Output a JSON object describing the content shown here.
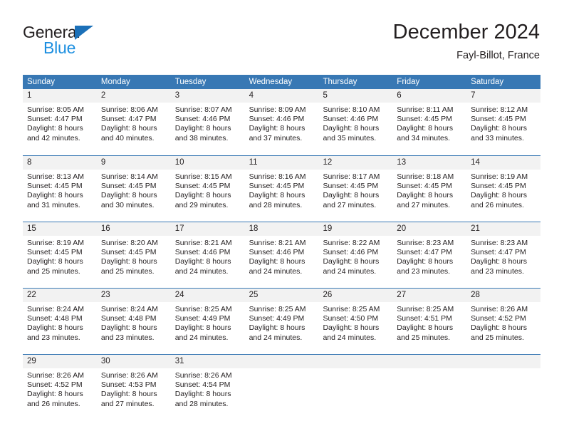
{
  "brand": {
    "name_top": "General",
    "name_bottom": "Blue",
    "color_dark": "#231f20",
    "color_blue": "#1b8ee0",
    "triangle_color": "#1b70b8"
  },
  "header": {
    "title": "December 2024",
    "location": "Fayl-Billot, France"
  },
  "theme": {
    "header_blue": "#3878b4",
    "day_band_gray": "#f2f2f2",
    "text": "#231f20"
  },
  "day_headers": [
    "Sunday",
    "Monday",
    "Tuesday",
    "Wednesday",
    "Thursday",
    "Friday",
    "Saturday"
  ],
  "weeks": [
    [
      {
        "day": "1",
        "sunrise": "Sunrise: 8:05 AM",
        "sunset": "Sunset: 4:47 PM",
        "daylight_1": "Daylight: 8 hours",
        "daylight_2": "and 42 minutes."
      },
      {
        "day": "2",
        "sunrise": "Sunrise: 8:06 AM",
        "sunset": "Sunset: 4:47 PM",
        "daylight_1": "Daylight: 8 hours",
        "daylight_2": "and 40 minutes."
      },
      {
        "day": "3",
        "sunrise": "Sunrise: 8:07 AM",
        "sunset": "Sunset: 4:46 PM",
        "daylight_1": "Daylight: 8 hours",
        "daylight_2": "and 38 minutes."
      },
      {
        "day": "4",
        "sunrise": "Sunrise: 8:09 AM",
        "sunset": "Sunset: 4:46 PM",
        "daylight_1": "Daylight: 8 hours",
        "daylight_2": "and 37 minutes."
      },
      {
        "day": "5",
        "sunrise": "Sunrise: 8:10 AM",
        "sunset": "Sunset: 4:46 PM",
        "daylight_1": "Daylight: 8 hours",
        "daylight_2": "and 35 minutes."
      },
      {
        "day": "6",
        "sunrise": "Sunrise: 8:11 AM",
        "sunset": "Sunset: 4:45 PM",
        "daylight_1": "Daylight: 8 hours",
        "daylight_2": "and 34 minutes."
      },
      {
        "day": "7",
        "sunrise": "Sunrise: 8:12 AM",
        "sunset": "Sunset: 4:45 PM",
        "daylight_1": "Daylight: 8 hours",
        "daylight_2": "and 33 minutes."
      }
    ],
    [
      {
        "day": "8",
        "sunrise": "Sunrise: 8:13 AM",
        "sunset": "Sunset: 4:45 PM",
        "daylight_1": "Daylight: 8 hours",
        "daylight_2": "and 31 minutes."
      },
      {
        "day": "9",
        "sunrise": "Sunrise: 8:14 AM",
        "sunset": "Sunset: 4:45 PM",
        "daylight_1": "Daylight: 8 hours",
        "daylight_2": "and 30 minutes."
      },
      {
        "day": "10",
        "sunrise": "Sunrise: 8:15 AM",
        "sunset": "Sunset: 4:45 PM",
        "daylight_1": "Daylight: 8 hours",
        "daylight_2": "and 29 minutes."
      },
      {
        "day": "11",
        "sunrise": "Sunrise: 8:16 AM",
        "sunset": "Sunset: 4:45 PM",
        "daylight_1": "Daylight: 8 hours",
        "daylight_2": "and 28 minutes."
      },
      {
        "day": "12",
        "sunrise": "Sunrise: 8:17 AM",
        "sunset": "Sunset: 4:45 PM",
        "daylight_1": "Daylight: 8 hours",
        "daylight_2": "and 27 minutes."
      },
      {
        "day": "13",
        "sunrise": "Sunrise: 8:18 AM",
        "sunset": "Sunset: 4:45 PM",
        "daylight_1": "Daylight: 8 hours",
        "daylight_2": "and 27 minutes."
      },
      {
        "day": "14",
        "sunrise": "Sunrise: 8:19 AM",
        "sunset": "Sunset: 4:45 PM",
        "daylight_1": "Daylight: 8 hours",
        "daylight_2": "and 26 minutes."
      }
    ],
    [
      {
        "day": "15",
        "sunrise": "Sunrise: 8:19 AM",
        "sunset": "Sunset: 4:45 PM",
        "daylight_1": "Daylight: 8 hours",
        "daylight_2": "and 25 minutes."
      },
      {
        "day": "16",
        "sunrise": "Sunrise: 8:20 AM",
        "sunset": "Sunset: 4:45 PM",
        "daylight_1": "Daylight: 8 hours",
        "daylight_2": "and 25 minutes."
      },
      {
        "day": "17",
        "sunrise": "Sunrise: 8:21 AM",
        "sunset": "Sunset: 4:46 PM",
        "daylight_1": "Daylight: 8 hours",
        "daylight_2": "and 24 minutes."
      },
      {
        "day": "18",
        "sunrise": "Sunrise: 8:21 AM",
        "sunset": "Sunset: 4:46 PM",
        "daylight_1": "Daylight: 8 hours",
        "daylight_2": "and 24 minutes."
      },
      {
        "day": "19",
        "sunrise": "Sunrise: 8:22 AM",
        "sunset": "Sunset: 4:46 PM",
        "daylight_1": "Daylight: 8 hours",
        "daylight_2": "and 24 minutes."
      },
      {
        "day": "20",
        "sunrise": "Sunrise: 8:23 AM",
        "sunset": "Sunset: 4:47 PM",
        "daylight_1": "Daylight: 8 hours",
        "daylight_2": "and 23 minutes."
      },
      {
        "day": "21",
        "sunrise": "Sunrise: 8:23 AM",
        "sunset": "Sunset: 4:47 PM",
        "daylight_1": "Daylight: 8 hours",
        "daylight_2": "and 23 minutes."
      }
    ],
    [
      {
        "day": "22",
        "sunrise": "Sunrise: 8:24 AM",
        "sunset": "Sunset: 4:48 PM",
        "daylight_1": "Daylight: 8 hours",
        "daylight_2": "and 23 minutes."
      },
      {
        "day": "23",
        "sunrise": "Sunrise: 8:24 AM",
        "sunset": "Sunset: 4:48 PM",
        "daylight_1": "Daylight: 8 hours",
        "daylight_2": "and 23 minutes."
      },
      {
        "day": "24",
        "sunrise": "Sunrise: 8:25 AM",
        "sunset": "Sunset: 4:49 PM",
        "daylight_1": "Daylight: 8 hours",
        "daylight_2": "and 24 minutes."
      },
      {
        "day": "25",
        "sunrise": "Sunrise: 8:25 AM",
        "sunset": "Sunset: 4:49 PM",
        "daylight_1": "Daylight: 8 hours",
        "daylight_2": "and 24 minutes."
      },
      {
        "day": "26",
        "sunrise": "Sunrise: 8:25 AM",
        "sunset": "Sunset: 4:50 PM",
        "daylight_1": "Daylight: 8 hours",
        "daylight_2": "and 24 minutes."
      },
      {
        "day": "27",
        "sunrise": "Sunrise: 8:25 AM",
        "sunset": "Sunset: 4:51 PM",
        "daylight_1": "Daylight: 8 hours",
        "daylight_2": "and 25 minutes."
      },
      {
        "day": "28",
        "sunrise": "Sunrise: 8:26 AM",
        "sunset": "Sunset: 4:52 PM",
        "daylight_1": "Daylight: 8 hours",
        "daylight_2": "and 25 minutes."
      }
    ],
    [
      {
        "day": "29",
        "sunrise": "Sunrise: 8:26 AM",
        "sunset": "Sunset: 4:52 PM",
        "daylight_1": "Daylight: 8 hours",
        "daylight_2": "and 26 minutes."
      },
      {
        "day": "30",
        "sunrise": "Sunrise: 8:26 AM",
        "sunset": "Sunset: 4:53 PM",
        "daylight_1": "Daylight: 8 hours",
        "daylight_2": "and 27 minutes."
      },
      {
        "day": "31",
        "sunrise": "Sunrise: 8:26 AM",
        "sunset": "Sunset: 4:54 PM",
        "daylight_1": "Daylight: 8 hours",
        "daylight_2": "and 28 minutes."
      },
      {
        "day": "",
        "sunrise": "",
        "sunset": "",
        "daylight_1": "",
        "daylight_2": ""
      },
      {
        "day": "",
        "sunrise": "",
        "sunset": "",
        "daylight_1": "",
        "daylight_2": ""
      },
      {
        "day": "",
        "sunrise": "",
        "sunset": "",
        "daylight_1": "",
        "daylight_2": ""
      },
      {
        "day": "",
        "sunrise": "",
        "sunset": "",
        "daylight_1": "",
        "daylight_2": ""
      }
    ]
  ]
}
